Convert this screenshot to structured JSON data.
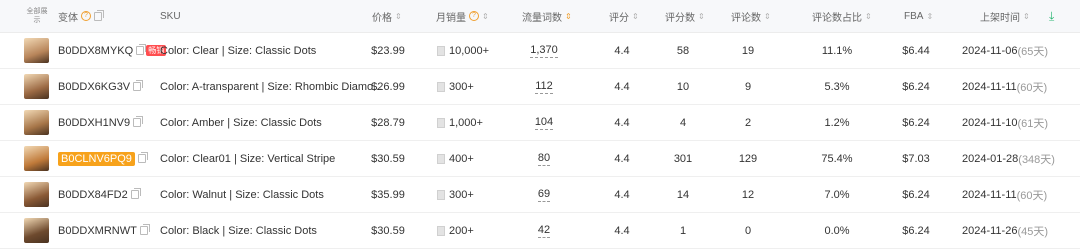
{
  "header": {
    "select_all": "全部展示",
    "variant": "变体",
    "sku": "SKU",
    "price": "价格",
    "monthly_sales": "月销量",
    "traffic_words": "流量词数",
    "rating": "评分",
    "rating_count": "评分数",
    "review_count": "评论数",
    "review_ratio": "评论数占比",
    "fba": "FBA",
    "listed_time": "上架时间",
    "sort_glyph": "⇕",
    "help_glyph": "?"
  },
  "hot_tag": "畅销",
  "rows": [
    {
      "asin": "B0DDX8MYKQ",
      "sku": "Color: Clear | Size: Classic Dots",
      "price": "$23.99",
      "sales": "10,000+",
      "words": "1,370",
      "rating": "4.4",
      "rating_count": "58",
      "reviews": "19",
      "ratio": "11.1%",
      "fba": "$6.44",
      "date": "2024-11-06",
      "days": "(65天)",
      "thumb": "#b8855a"
    },
    {
      "asin": "B0DDX6KG3V",
      "sku": "Color: A-transparent | Size: Rhombic Diamo...",
      "price": "$26.99",
      "sales": "300+",
      "words": "112",
      "rating": "4.4",
      "rating_count": "10",
      "reviews": "9",
      "ratio": "5.3%",
      "fba": "$6.24",
      "date": "2024-11-11",
      "days": "(60天)",
      "thumb": "#9c6a44"
    },
    {
      "asin": "B0DDXH1NV9",
      "sku": "Color: Amber | Size: Classic Dots",
      "price": "$28.79",
      "sales": "1,000+",
      "words": "104",
      "rating": "4.4",
      "rating_count": "4",
      "reviews": "2",
      "ratio": "1.2%",
      "fba": "$6.24",
      "date": "2024-11-10",
      "days": "(61天)",
      "thumb": "#a77649"
    },
    {
      "asin": "B0CLNV6PQ9",
      "sku": "Color: Clear01 | Size: Vertical Stripe",
      "price": "$30.59",
      "sales": "400+",
      "words": "80",
      "rating": "4.4",
      "rating_count": "301",
      "reviews": "129",
      "ratio": "75.4%",
      "fba": "$7.03",
      "date": "2024-01-28",
      "days": "(348天)",
      "thumb": "#c07a3a"
    },
    {
      "asin": "B0DDX84FD2",
      "sku": "Color: Walnut | Size: Classic Dots",
      "price": "$35.99",
      "sales": "300+",
      "words": "69",
      "rating": "4.4",
      "rating_count": "14",
      "reviews": "12",
      "ratio": "7.0%",
      "fba": "$6.24",
      "date": "2024-11-11",
      "days": "(60天)",
      "thumb": "#8a5a36"
    },
    {
      "asin": "B0DDXMRNWT",
      "sku": "Color: Black | Size: Classic Dots",
      "price": "$30.59",
      "sales": "200+",
      "words": "42",
      "rating": "4.4",
      "rating_count": "1",
      "reviews": "0",
      "ratio": "0.0%",
      "fba": "$6.24",
      "date": "2024-11-26",
      "days": "(45天)",
      "thumb": "#6e4a2e"
    }
  ]
}
